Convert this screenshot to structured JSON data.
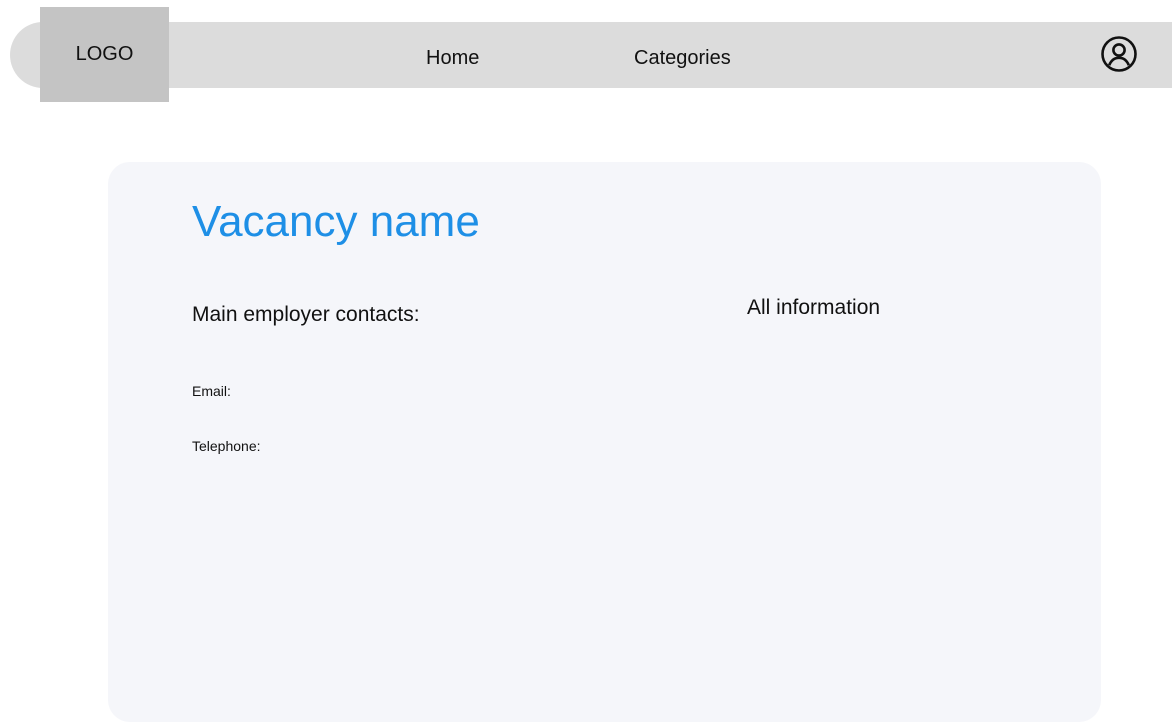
{
  "header": {
    "logo_text": "LOGO",
    "nav": {
      "home_label": "Home",
      "categories_label": "Categories"
    },
    "profile_icon": "user-circle-icon"
  },
  "vacancy": {
    "title": "Vacancy name",
    "contacts_heading": "Main employer contacts:",
    "email_label": "Email:",
    "telephone_label": "Telephone:",
    "all_info_heading": "All information"
  },
  "colors": {
    "navbar_bg": "#dcdcdc",
    "logo_bg": "#c4c4c4",
    "card_bg": "#f5f6fa",
    "title_accent": "#1e8fe6"
  }
}
